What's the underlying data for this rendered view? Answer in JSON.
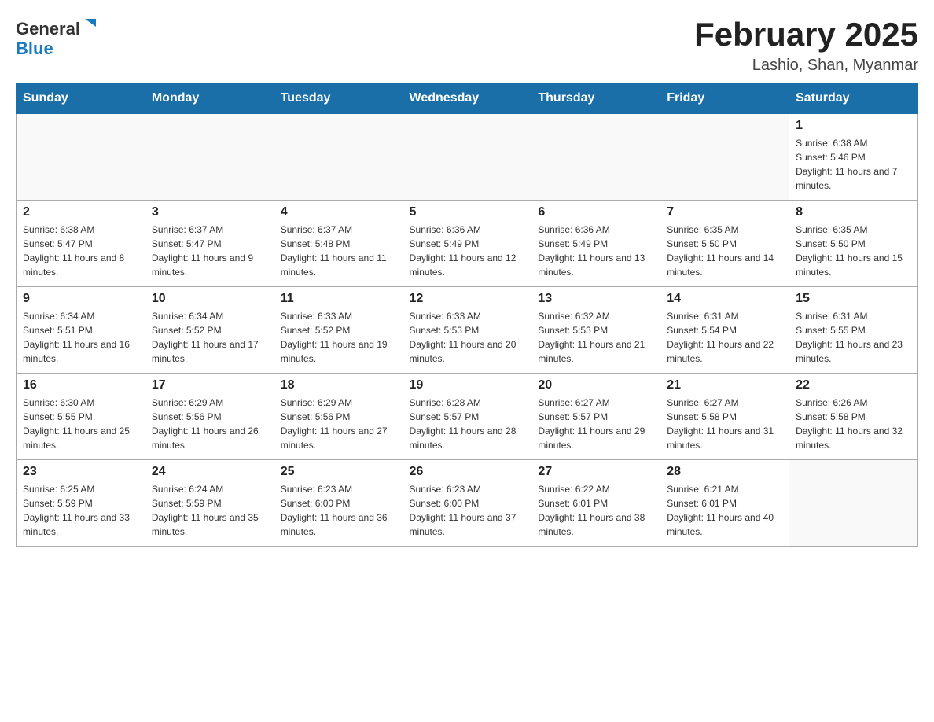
{
  "logo": {
    "general": "General",
    "arrow": "▶",
    "blue": "Blue"
  },
  "header": {
    "month": "February 2025",
    "location": "Lashio, Shan, Myanmar"
  },
  "weekdays": [
    "Sunday",
    "Monday",
    "Tuesday",
    "Wednesday",
    "Thursday",
    "Friday",
    "Saturday"
  ],
  "weeks": [
    [
      {
        "day": "",
        "sunrise": "",
        "sunset": "",
        "daylight": ""
      },
      {
        "day": "",
        "sunrise": "",
        "sunset": "",
        "daylight": ""
      },
      {
        "day": "",
        "sunrise": "",
        "sunset": "",
        "daylight": ""
      },
      {
        "day": "",
        "sunrise": "",
        "sunset": "",
        "daylight": ""
      },
      {
        "day": "",
        "sunrise": "",
        "sunset": "",
        "daylight": ""
      },
      {
        "day": "",
        "sunrise": "",
        "sunset": "",
        "daylight": ""
      },
      {
        "day": "1",
        "sunrise": "Sunrise: 6:38 AM",
        "sunset": "Sunset: 5:46 PM",
        "daylight": "Daylight: 11 hours and 7 minutes."
      }
    ],
    [
      {
        "day": "2",
        "sunrise": "Sunrise: 6:38 AM",
        "sunset": "Sunset: 5:47 PM",
        "daylight": "Daylight: 11 hours and 8 minutes."
      },
      {
        "day": "3",
        "sunrise": "Sunrise: 6:37 AM",
        "sunset": "Sunset: 5:47 PM",
        "daylight": "Daylight: 11 hours and 9 minutes."
      },
      {
        "day": "4",
        "sunrise": "Sunrise: 6:37 AM",
        "sunset": "Sunset: 5:48 PM",
        "daylight": "Daylight: 11 hours and 11 minutes."
      },
      {
        "day": "5",
        "sunrise": "Sunrise: 6:36 AM",
        "sunset": "Sunset: 5:49 PM",
        "daylight": "Daylight: 11 hours and 12 minutes."
      },
      {
        "day": "6",
        "sunrise": "Sunrise: 6:36 AM",
        "sunset": "Sunset: 5:49 PM",
        "daylight": "Daylight: 11 hours and 13 minutes."
      },
      {
        "day": "7",
        "sunrise": "Sunrise: 6:35 AM",
        "sunset": "Sunset: 5:50 PM",
        "daylight": "Daylight: 11 hours and 14 minutes."
      },
      {
        "day": "8",
        "sunrise": "Sunrise: 6:35 AM",
        "sunset": "Sunset: 5:50 PM",
        "daylight": "Daylight: 11 hours and 15 minutes."
      }
    ],
    [
      {
        "day": "9",
        "sunrise": "Sunrise: 6:34 AM",
        "sunset": "Sunset: 5:51 PM",
        "daylight": "Daylight: 11 hours and 16 minutes."
      },
      {
        "day": "10",
        "sunrise": "Sunrise: 6:34 AM",
        "sunset": "Sunset: 5:52 PM",
        "daylight": "Daylight: 11 hours and 17 minutes."
      },
      {
        "day": "11",
        "sunrise": "Sunrise: 6:33 AM",
        "sunset": "Sunset: 5:52 PM",
        "daylight": "Daylight: 11 hours and 19 minutes."
      },
      {
        "day": "12",
        "sunrise": "Sunrise: 6:33 AM",
        "sunset": "Sunset: 5:53 PM",
        "daylight": "Daylight: 11 hours and 20 minutes."
      },
      {
        "day": "13",
        "sunrise": "Sunrise: 6:32 AM",
        "sunset": "Sunset: 5:53 PM",
        "daylight": "Daylight: 11 hours and 21 minutes."
      },
      {
        "day": "14",
        "sunrise": "Sunrise: 6:31 AM",
        "sunset": "Sunset: 5:54 PM",
        "daylight": "Daylight: 11 hours and 22 minutes."
      },
      {
        "day": "15",
        "sunrise": "Sunrise: 6:31 AM",
        "sunset": "Sunset: 5:55 PM",
        "daylight": "Daylight: 11 hours and 23 minutes."
      }
    ],
    [
      {
        "day": "16",
        "sunrise": "Sunrise: 6:30 AM",
        "sunset": "Sunset: 5:55 PM",
        "daylight": "Daylight: 11 hours and 25 minutes."
      },
      {
        "day": "17",
        "sunrise": "Sunrise: 6:29 AM",
        "sunset": "Sunset: 5:56 PM",
        "daylight": "Daylight: 11 hours and 26 minutes."
      },
      {
        "day": "18",
        "sunrise": "Sunrise: 6:29 AM",
        "sunset": "Sunset: 5:56 PM",
        "daylight": "Daylight: 11 hours and 27 minutes."
      },
      {
        "day": "19",
        "sunrise": "Sunrise: 6:28 AM",
        "sunset": "Sunset: 5:57 PM",
        "daylight": "Daylight: 11 hours and 28 minutes."
      },
      {
        "day": "20",
        "sunrise": "Sunrise: 6:27 AM",
        "sunset": "Sunset: 5:57 PM",
        "daylight": "Daylight: 11 hours and 29 minutes."
      },
      {
        "day": "21",
        "sunrise": "Sunrise: 6:27 AM",
        "sunset": "Sunset: 5:58 PM",
        "daylight": "Daylight: 11 hours and 31 minutes."
      },
      {
        "day": "22",
        "sunrise": "Sunrise: 6:26 AM",
        "sunset": "Sunset: 5:58 PM",
        "daylight": "Daylight: 11 hours and 32 minutes."
      }
    ],
    [
      {
        "day": "23",
        "sunrise": "Sunrise: 6:25 AM",
        "sunset": "Sunset: 5:59 PM",
        "daylight": "Daylight: 11 hours and 33 minutes."
      },
      {
        "day": "24",
        "sunrise": "Sunrise: 6:24 AM",
        "sunset": "Sunset: 5:59 PM",
        "daylight": "Daylight: 11 hours and 35 minutes."
      },
      {
        "day": "25",
        "sunrise": "Sunrise: 6:23 AM",
        "sunset": "Sunset: 6:00 PM",
        "daylight": "Daylight: 11 hours and 36 minutes."
      },
      {
        "day": "26",
        "sunrise": "Sunrise: 6:23 AM",
        "sunset": "Sunset: 6:00 PM",
        "daylight": "Daylight: 11 hours and 37 minutes."
      },
      {
        "day": "27",
        "sunrise": "Sunrise: 6:22 AM",
        "sunset": "Sunset: 6:01 PM",
        "daylight": "Daylight: 11 hours and 38 minutes."
      },
      {
        "day": "28",
        "sunrise": "Sunrise: 6:21 AM",
        "sunset": "Sunset: 6:01 PM",
        "daylight": "Daylight: 11 hours and 40 minutes."
      },
      {
        "day": "",
        "sunrise": "",
        "sunset": "",
        "daylight": ""
      }
    ]
  ]
}
